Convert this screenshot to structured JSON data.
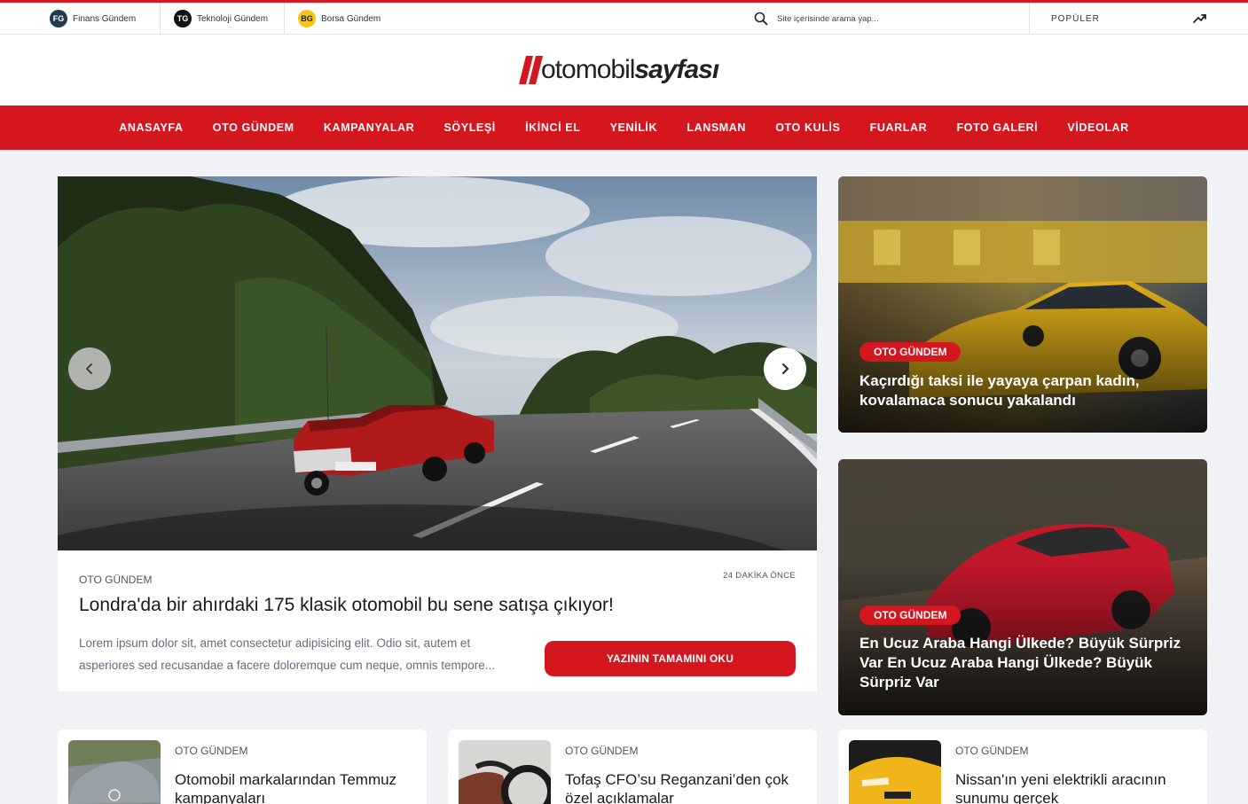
{
  "topbar": {
    "links": [
      {
        "badge": "FG",
        "label": "Finans Gündem",
        "badge_bg": "#1f3b4d",
        "badge_fg": "#ffffff"
      },
      {
        "badge": "TG",
        "label": "Teknoloji Gündem",
        "badge_bg": "#111111",
        "badge_fg": "#ffffff"
      },
      {
        "badge": "BG",
        "label": "Borsa Gündem",
        "badge_bg": "#f5c518",
        "badge_fg": "#222222"
      }
    ],
    "search_placeholder": "Site içerisinde arama yap...",
    "popular_label": "POPÜLER",
    "trend_icon": "trending-up-icon"
  },
  "logo": {
    "part1": "otomobil",
    "part2": "sayfası"
  },
  "nav": {
    "items": [
      "ANASAYFA",
      "OTO GÜNDEM",
      "KAMPANYALAR",
      "SÖYLEŞİ",
      "İKİNCİ EL",
      "YENİLİK",
      "LANSMAN",
      "OTO KULİS",
      "FUARLAR",
      "FOTO GALERİ",
      "VİDEOLAR"
    ]
  },
  "hero": {
    "category": "OTO GÜNDEM",
    "time": "24 DAKİKA ÖNCE",
    "title": "Londra'da bir ahırdaki 175 klasik otomobil bu sene satışa çıkıyor!",
    "excerpt": "Lorem ipsum dolor sit, amet consectetur adipisicing elit. Odio sit, autem et asperiores sed recusandae a facere doloremque cum neque, omnis tempore...",
    "button": "YAZININ TAMAMINI OKU"
  },
  "side_cards": [
    {
      "tag": "OTO GÜNDEM",
      "title": "Kaçırdığı taksi ile yayaya çarpan kadın, kovalamaca sonucu yakalandı"
    },
    {
      "tag": "OTO GÜNDEM",
      "title": "En Ucuz Araba Hangi Ülkede? Büyük Sürpriz Var En Ucuz Araba Hangi Ülkede? Büyük Sürpriz Var"
    }
  ],
  "bottom_cards": [
    {
      "category": "OTO GÜNDEM",
      "title": "Otomobil markalarından Temmuz kampanyaları"
    },
    {
      "category": "OTO GÜNDEM",
      "title": "Tofaş CFO’su Reganzani’den çok özel açıklamalar"
    },
    {
      "category": "OTO GÜNDEM",
      "title": "Nissan'ın yeni elektrikli aracının sunumu gerçek"
    }
  ],
  "colors": {
    "accent": "#d4161e"
  }
}
